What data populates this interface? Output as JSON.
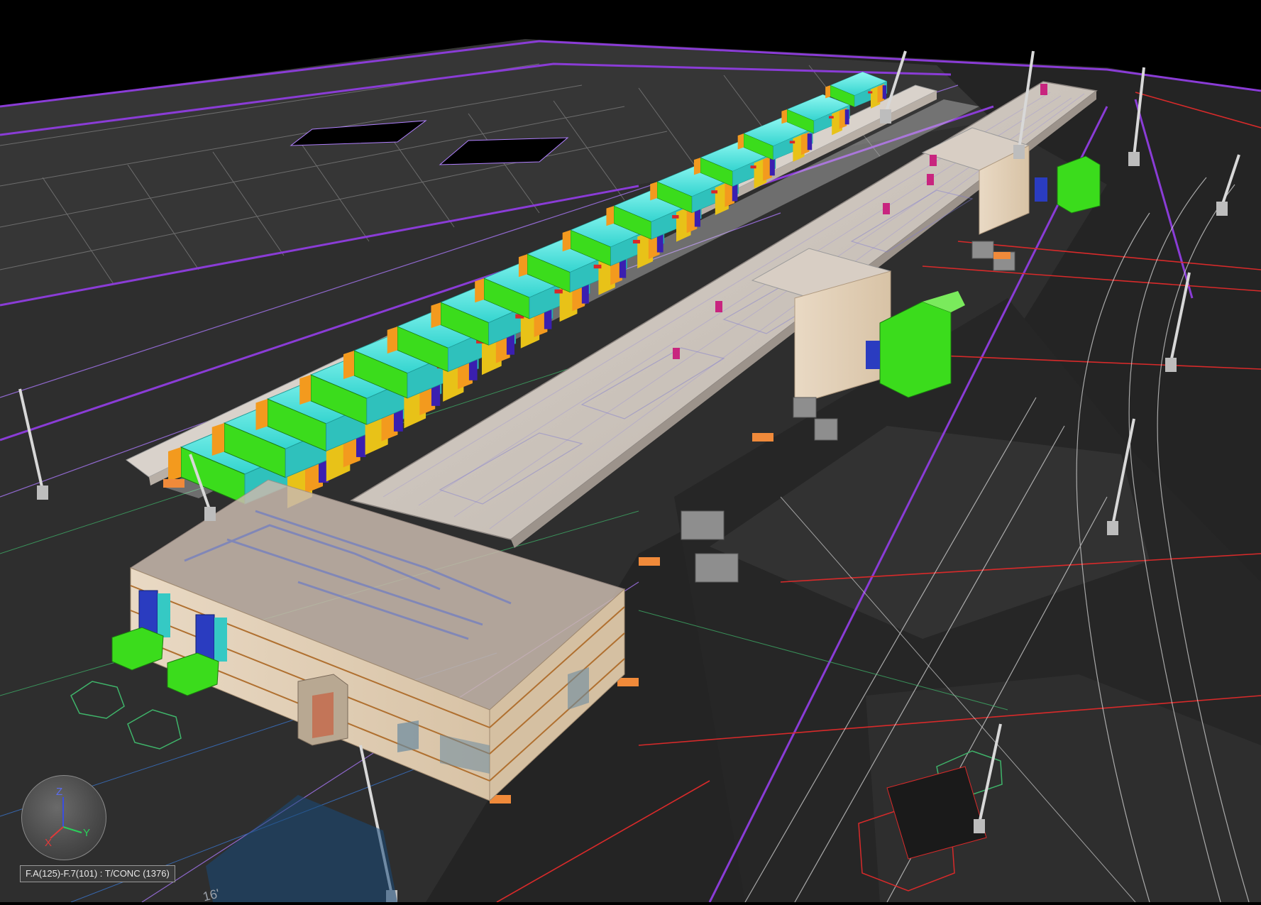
{
  "viewer": {
    "status_text": "F.A(125)-F.7(101) : T/CONC (1376)",
    "dimension_label": "16'",
    "nav_cube": {
      "axis_z": "Z",
      "axis_y": "Y",
      "axis_x": "X"
    }
  },
  "colors": {
    "background": "#000000",
    "ground": "#2b2b2b",
    "guide_purple": "#8a3cd6",
    "unit_cyan": "#4fe8e0",
    "unit_green": "#3bdc1c",
    "unit_orange": "#f39a1e",
    "unit_yellow": "#e8c218",
    "unit_blue": "#3a1fb0",
    "roof_tan": "#cfc6bd",
    "site_red": "#d82a2a",
    "light_pole": "#d8d8d8"
  },
  "icons": [
    "axis-triad-icon",
    "light-pole-icon"
  ]
}
